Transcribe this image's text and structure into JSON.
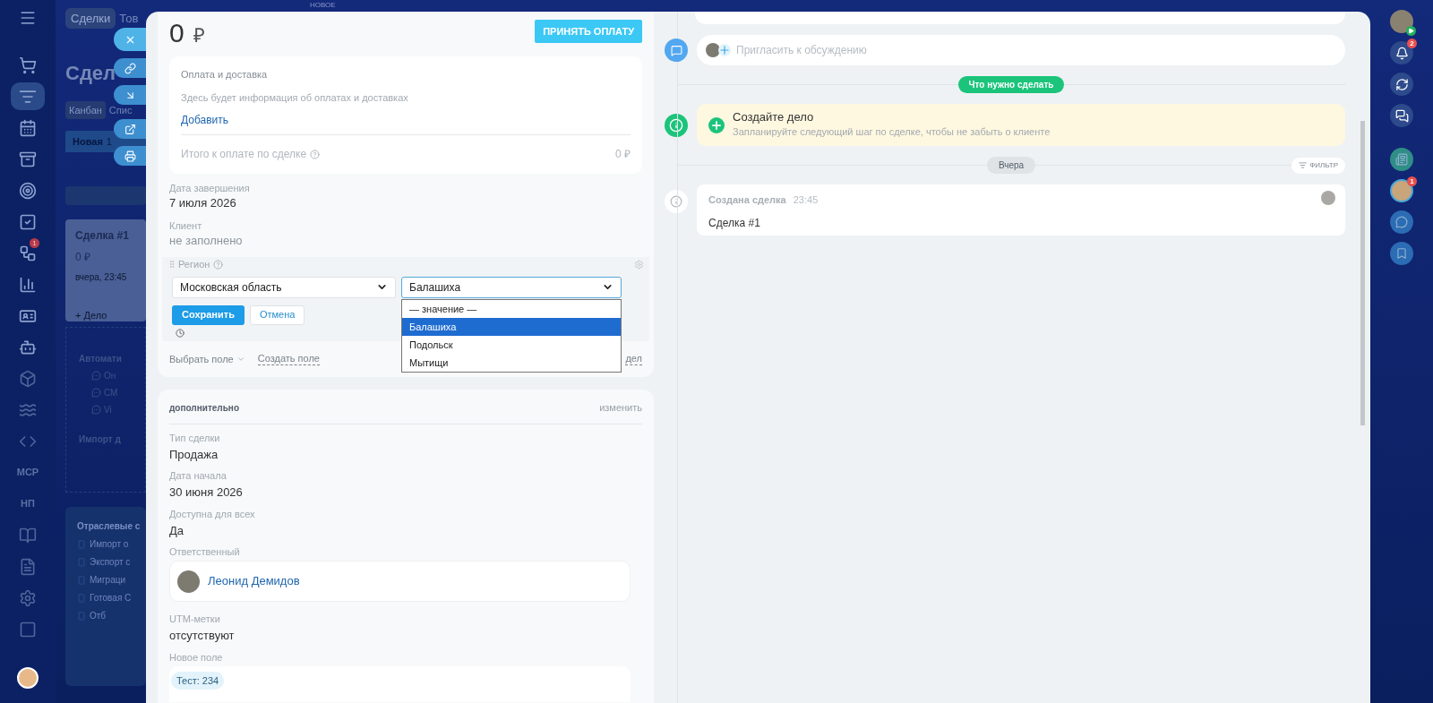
{
  "left_nav": {
    "items": [
      {
        "selected": false
      },
      {
        "selected": true
      },
      {
        "selected": false
      },
      {
        "selected": false
      },
      {
        "selected": false
      },
      {
        "selected": false
      },
      {
        "selected": false,
        "badge": "1"
      },
      {
        "selected": false
      },
      {
        "selected": false
      },
      {
        "selected": false
      },
      {
        "selected": false
      },
      {
        "selected": false
      },
      {
        "selected": false
      },
      {
        "selected": false,
        "label": "MCP"
      },
      {
        "selected": false,
        "label": "НП"
      },
      {
        "selected": false
      },
      {
        "selected": false
      },
      {
        "selected": false
      },
      {
        "selected": false
      }
    ]
  },
  "board": {
    "tabs": [
      {
        "label": "Сделки",
        "selected": true
      },
      {
        "label": "Тов",
        "selected": false
      }
    ],
    "new_badge": "НОВОЕ",
    "title": "Сдел",
    "view_tabs": [
      {
        "label": "Канбан",
        "selected": true
      },
      {
        "label": "Спис",
        "selected": false
      }
    ],
    "column": {
      "name": "Новая",
      "count": "1"
    },
    "card": {
      "title": "Сделка #1",
      "amount": "0 ₽",
      "time": "вчера, 23:45",
      "action": "+ Дело"
    },
    "automation": {
      "title": "Автомати",
      "items": [
        "Он",
        "СМ",
        "Vi"
      ],
      "import": "Импорт д"
    },
    "industry": {
      "title": "Отраслевые с",
      "items": [
        "Импорт о",
        "Экспорт с",
        "Миграци",
        "Готовая С",
        "Отб"
      ]
    }
  },
  "deal": {
    "amount": "0",
    "currency": "₽",
    "pay_button": "ПРИНЯТЬ ОПЛАТУ",
    "payments": {
      "title": "Оплата и доставка",
      "info": "Здесь будет информация об оплатах и доставках",
      "add_link": "Добавить",
      "total_label": "Итого к оплате по сделке",
      "total_value": "0 ₽"
    },
    "fields": [
      {
        "label": "Дата завершения",
        "value": "7 июля 2026",
        "empty": false
      },
      {
        "label": "Клиент",
        "value": "не заполнено",
        "empty": true
      }
    ],
    "region": {
      "label": "Регион",
      "select_1": "Московская область",
      "select_2": "Балашиха",
      "options": [
        {
          "label": "— значение —",
          "selected": false
        },
        {
          "label": "Балашиха",
          "selected": true
        },
        {
          "label": "Подольск",
          "selected": false
        },
        {
          "label": "Мытищи",
          "selected": false
        }
      ],
      "save": "Сохранить",
      "cancel": "Отмена"
    },
    "footer": {
      "choose_field": "Выбрать поле",
      "create_field": "Создать поле",
      "right_link": "дел"
    }
  },
  "additional": {
    "title": "дополнительно",
    "edit": "изменить",
    "fields": [
      {
        "kind": "text",
        "label": "Тип сделки",
        "value": "Продажа"
      },
      {
        "kind": "text",
        "label": "Дата начала",
        "value": "30 июня 2026"
      },
      {
        "kind": "text",
        "label": "Доступна для всех",
        "value": "Да"
      },
      {
        "kind": "person",
        "label": "Ответственный",
        "value": "Леонид Демидов"
      },
      {
        "kind": "text",
        "label": "UTM-метки",
        "value": "отсутствуют"
      },
      {
        "kind": "tags",
        "label": "Новое поле",
        "value": "Тест: 234"
      }
    ]
  },
  "timeline": {
    "comment_placeholder": "Пригласить к обсуждению",
    "todo_divider": "Что нужно сделать",
    "todo": {
      "title": "Создайте дело",
      "hint": "Запланируйте следующий шаг по сделке, чтобы не забыть о клиенте"
    },
    "date_divider": "Вчера",
    "filter": "ФИЛЬТР",
    "events": [
      {
        "title": "Создана сделка",
        "time": "23:45",
        "body": "Сделка #1"
      }
    ]
  },
  "right_rail": {
    "items": [
      {
        "kind": "avatar"
      },
      {
        "kind": "icon",
        "badge": "2"
      },
      {
        "kind": "icon"
      },
      {
        "kind": "icon"
      },
      {
        "kind": "app"
      },
      {
        "kind": "avatar",
        "badge": "1"
      },
      {
        "kind": "app"
      },
      {
        "kind": "app"
      }
    ]
  }
}
